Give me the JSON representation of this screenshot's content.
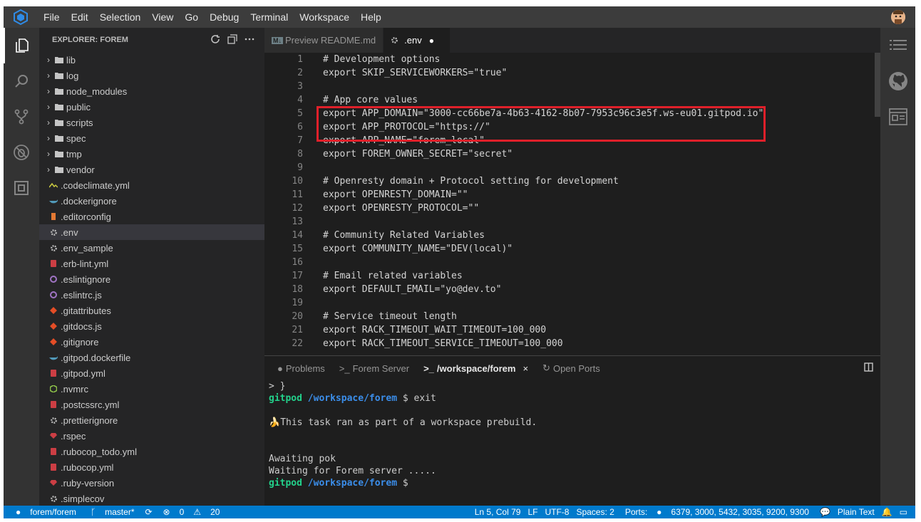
{
  "menu": [
    "File",
    "Edit",
    "Selection",
    "View",
    "Go",
    "Debug",
    "Terminal",
    "Workspace",
    "Help"
  ],
  "explorer": {
    "title": "EXPLORER: FOREM",
    "folders": [
      "lib",
      "log",
      "node_modules",
      "public",
      "scripts",
      "spec",
      "tmp",
      "vendor"
    ],
    "files": [
      ".codeclimate.yml",
      ".dockerignore",
      ".editorconfig",
      ".env",
      ".env_sample",
      ".erb-lint.yml",
      ".eslintignore",
      ".eslintrc.js",
      ".gitattributes",
      ".gitdocs.js",
      ".gitignore",
      ".gitpod.dockerfile",
      ".gitpod.yml",
      ".nvmrc",
      ".postcssrc.yml",
      ".prettierignore",
      ".rspec",
      ".rubocop_todo.yml",
      ".rubocop.yml",
      ".ruby-version",
      ".simplecov"
    ],
    "selected_file": ".env"
  },
  "tabs": [
    {
      "label": "Preview README.md",
      "badge": "M↓"
    },
    {
      "label": ".env",
      "dirty_dot": "●"
    }
  ],
  "code_lines": [
    "# Development options",
    "export SKIP_SERVICEWORKERS=\"true\"",
    "",
    "# App core values",
    "export APP_DOMAIN=\"3000-cc66be7a-4b63-4162-8b07-7953c96c3e5f.ws-eu01.gitpod.io\"",
    "export APP_PROTOCOL=\"https://\"",
    "export APP_NAME=\"forem_local\"",
    "export FOREM_OWNER_SECRET=\"secret\"",
    "",
    "# Openresty domain + Protocol setting for development",
    "export OPENRESTY_DOMAIN=\"\"",
    "export OPENRESTY_PROTOCOL=\"\"",
    "",
    "# Community Related Variables",
    "export COMMUNITY_NAME=\"DEV(local)\"",
    "",
    "# Email related variables",
    "export DEFAULT_EMAIL=\"yo@dev.to\"",
    "",
    "# Service timeout length",
    "export RACK_TIMEOUT_WAIT_TIMEOUT=100_000",
    "export RACK_TIMEOUT_SERVICE_TIMEOUT=100_000"
  ],
  "panel": {
    "tabs": [
      "Problems",
      "Forem Server",
      "/workspace/forem",
      "Open Ports"
    ],
    "active_tab_close": "×"
  },
  "terminal": {
    "line1": "> }",
    "prompt_user": "gitpod",
    "prompt_path": "/workspace/forem",
    "prompt_symbol": "$",
    "cmd": "exit",
    "prebuild": "This task ran as part of a workspace prebuild.",
    "await": "Awaiting pok",
    "waiting": "Waiting for Forem server ....."
  },
  "status": {
    "repo": "forem/forem",
    "branch": "master*",
    "errors": "0",
    "warnings": "20",
    "position": "Ln 5, Col 79",
    "eol": "LF",
    "encoding": "UTF-8",
    "spaces": "Spaces: 2",
    "ports_label": "Ports:",
    "ports": "6379, 3000, 5432, 3035, 9200, 9300",
    "language": "Plain Text"
  },
  "colors": {
    "accent": "#007acc",
    "highlight_box": "#e0202a",
    "terminal_green": "#23d18b",
    "terminal_blue": "#3b8eea"
  }
}
